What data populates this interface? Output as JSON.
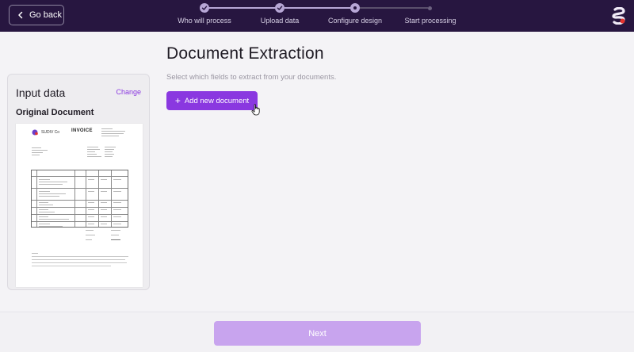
{
  "header": {
    "back_label": "Go back",
    "steps": [
      {
        "label": "Who will process",
        "state": "done"
      },
      {
        "label": "Upload data",
        "state": "done"
      },
      {
        "label": "Configure design",
        "state": "current"
      },
      {
        "label": "Start processing",
        "state": "future"
      }
    ]
  },
  "input_panel": {
    "title": "Input data",
    "change_label": "Change",
    "document_title": "Original Document",
    "thumbnail": {
      "brand": "SUDIV Co",
      "title": "INVOICE"
    }
  },
  "main": {
    "title": "Document Extraction",
    "subtitle": "Select which fields to extract from your documents.",
    "add_button_label": "Add new document"
  },
  "footer": {
    "next_label": "Next"
  },
  "colors": {
    "header_bg": "#271640",
    "accent": "#8a38e0",
    "next_disabled": "#c8a4ee"
  }
}
